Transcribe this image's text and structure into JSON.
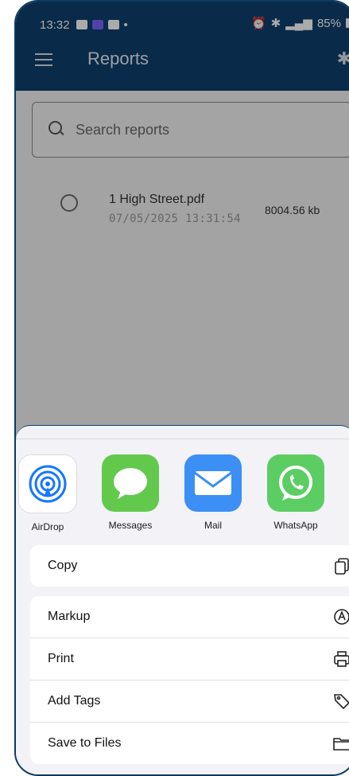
{
  "status": {
    "time": "13:32",
    "right_text": "85%"
  },
  "appbar": {
    "title": "Reports"
  },
  "search": {
    "placeholder": "Search reports"
  },
  "files": [
    {
      "name": "1 High Street.pdf",
      "date": "07/05/2025 13:31:54",
      "size": "8004.56 kb"
    }
  ],
  "share": {
    "apps": [
      {
        "label": "AirDrop",
        "icon": "airdrop-icon"
      },
      {
        "label": "Messages",
        "icon": "messages-icon"
      },
      {
        "label": "Mail",
        "icon": "mail-icon"
      },
      {
        "label": "WhatsApp",
        "icon": "whatsapp-icon"
      }
    ],
    "primary_actions": [
      {
        "label": "Copy",
        "icon": "copy-icon"
      }
    ],
    "actions": [
      {
        "label": "Markup",
        "icon": "markup-icon"
      },
      {
        "label": "Print",
        "icon": "print-icon"
      },
      {
        "label": "Add Tags",
        "icon": "tag-icon"
      },
      {
        "label": "Save to Files",
        "icon": "folder-icon"
      }
    ]
  },
  "colors": {
    "header": "#0e3f6e",
    "sheet_background": "#f2f2f7"
  }
}
